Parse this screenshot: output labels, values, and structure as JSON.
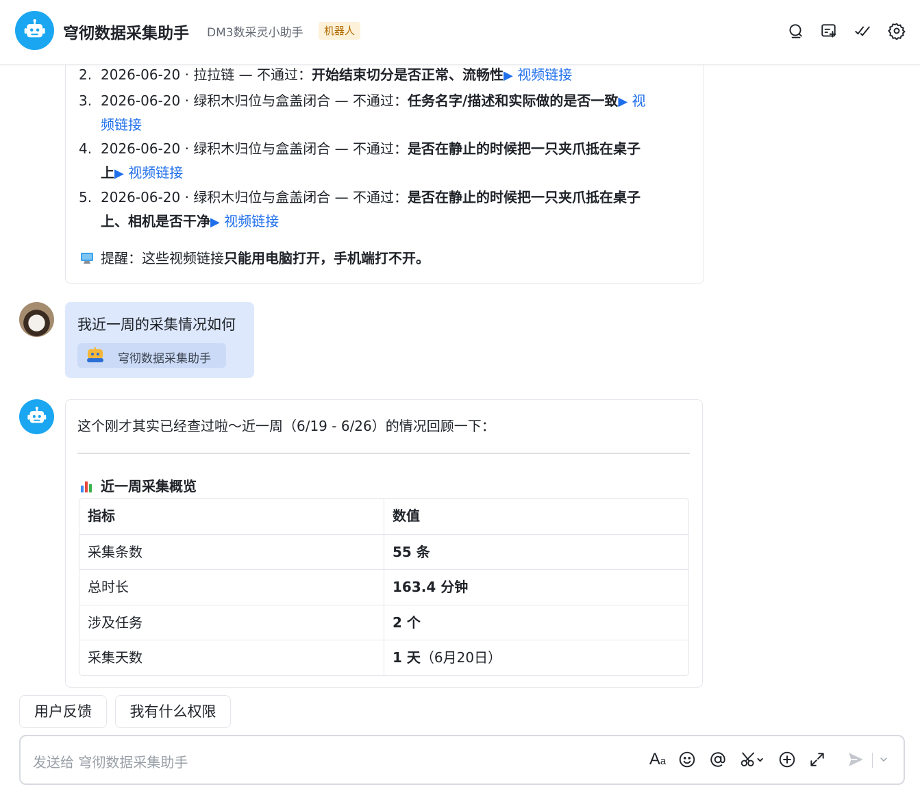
{
  "header": {
    "title": "穹彻数据采集助手",
    "subtitle": "DM3数采灵小助手",
    "tag": "机器人",
    "icons": [
      "search-icon",
      "new-chat-icon",
      "check-icon",
      "settings-icon"
    ]
  },
  "message1": {
    "items": [
      {
        "num": "2.",
        "date": "2026-06-20",
        "task": "拉拉链",
        "status": "— 不通过：",
        "reason": "开始结束切分是否正常、流畅性",
        "link": "视频链接"
      },
      {
        "num": "3.",
        "date": "2026-06-20",
        "task": "绿积木归位与盒盖闭合",
        "status": "— 不通过：",
        "reason": "任务名字/描述和实际做的是否一致",
        "link_a": "视",
        "link_b": "频链接"
      },
      {
        "num": "4.",
        "date": "2026-06-20",
        "task": "绿积木归位与盒盖闭合",
        "status": "— 不通过：",
        "reason_a": "是否在静止的时候把一只夹爪抵在桌子",
        "reason_b": "上",
        "link": "视频链接"
      },
      {
        "num": "5.",
        "date": "2026-06-20",
        "task": "绿积木归位与盒盖闭合",
        "status": "— 不通过：",
        "reason_a": "是否在静止的时候把一只夹爪抵在桌子",
        "reason_b": "上、相机是否干净",
        "link": "视频链接"
      }
    ],
    "reminder_prefix": "提醒：这些视频链接",
    "reminder_bold": "只能用电脑打开，手机端打不开。"
  },
  "user_message": {
    "text": "我近一周的采集情况如何",
    "mention": "穹彻数据采集助手"
  },
  "message2": {
    "intro": "这个刚才其实已经查过啦～近一周（6/19 - 6/26）的情况回顾一下：",
    "section_title": "近一周采集概览",
    "table": {
      "headers": [
        "指标",
        "数值"
      ],
      "rows": [
        {
          "metric": "采集条数",
          "value": "55 条",
          "note": ""
        },
        {
          "metric": "总时长",
          "value": "163.4 分钟",
          "note": ""
        },
        {
          "metric": "涉及任务",
          "value": "2 个",
          "note": ""
        },
        {
          "metric": "采集天数",
          "value": "1 天",
          "note": "（6月20日）"
        }
      ]
    }
  },
  "quick_replies": [
    "用户反馈",
    "我有什么权限"
  ],
  "composer": {
    "placeholder": "发送给 穹彻数据采集助手",
    "format_label": "A",
    "format_sub": "a",
    "tools": [
      "format-icon",
      "emoji-icon",
      "mention-icon",
      "scissors-icon",
      "plus-circle-icon",
      "expand-icon",
      "send-icon",
      "chevron-down-icon"
    ]
  },
  "colors": {
    "accent": "#1aa6f0",
    "link": "#1f6feb",
    "user_bubble": "#dde8fc",
    "tag_bg": "#fdf1d9",
    "tag_text": "#b26b00"
  }
}
